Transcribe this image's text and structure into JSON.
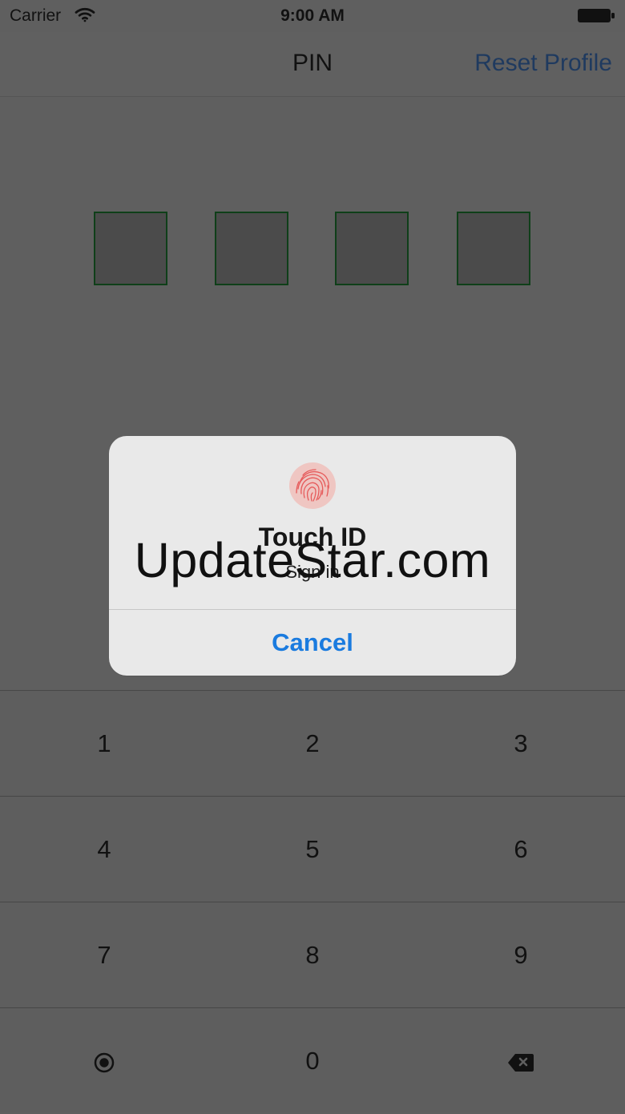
{
  "status_bar": {
    "carrier": "Carrier",
    "time": "9:00 AM",
    "wifi_icon": "wifi-icon",
    "battery_icon": "battery-icon"
  },
  "navigation": {
    "title": "PIN",
    "reset_profile_label": "Reset Profile"
  },
  "pin_entry": {
    "boxes": [
      "",
      "",
      "",
      ""
    ]
  },
  "keypad": {
    "rows": [
      [
        "1",
        "2",
        "3"
      ],
      [
        "4",
        "5",
        "6"
      ],
      [
        "7",
        "8",
        "9"
      ],
      [
        "fingerprint-icon",
        "0",
        "backspace-icon"
      ]
    ],
    "digit_0": "0",
    "digit_1": "1",
    "digit_2": "2",
    "digit_3": "3",
    "digit_4": "4",
    "digit_5": "5",
    "digit_6": "6",
    "digit_7": "7",
    "digit_8": "8",
    "digit_9": "9"
  },
  "touch_id_alert": {
    "title": "Touch ID",
    "subtitle": "Sign in",
    "cancel_label": "Cancel",
    "icon": "fingerprint-icon"
  },
  "watermark": "UpdateStar.com",
  "colors": {
    "background": "#5f5f5f",
    "pin_box_fill": "#4b4b4b",
    "pin_box_border": "#0f3f19",
    "nav_action": "#1f3a5f",
    "alert_background": "#e9e9e9",
    "alert_action": "#1a7bdf"
  }
}
